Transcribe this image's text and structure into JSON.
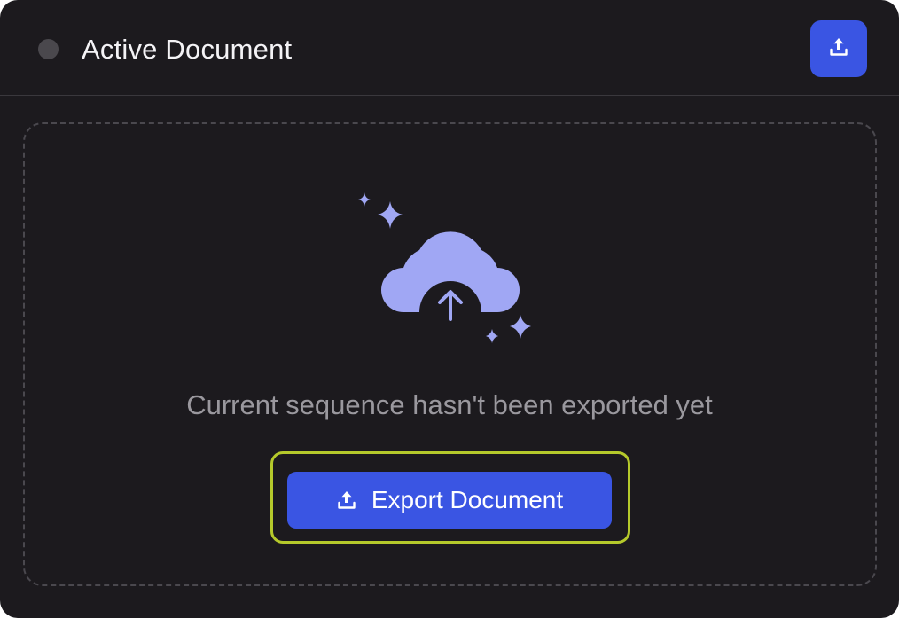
{
  "header": {
    "title": "Active Document",
    "status_indicator": "inactive",
    "export_icon": "upload-icon"
  },
  "empty_state": {
    "illustration": "cloud-upload-sparkles-icon",
    "message": "Current sequence hasn't been exported yet",
    "button_label": "Export Document",
    "button_icon": "upload-icon",
    "button_focused": true
  },
  "colors": {
    "background": "#1c1a1e",
    "accent": "#3a55e3",
    "illustration": "#a0a7f4",
    "focus_ring": "#b5c92b",
    "muted_text": "#9a989e",
    "status_dot": "#4a484d"
  }
}
